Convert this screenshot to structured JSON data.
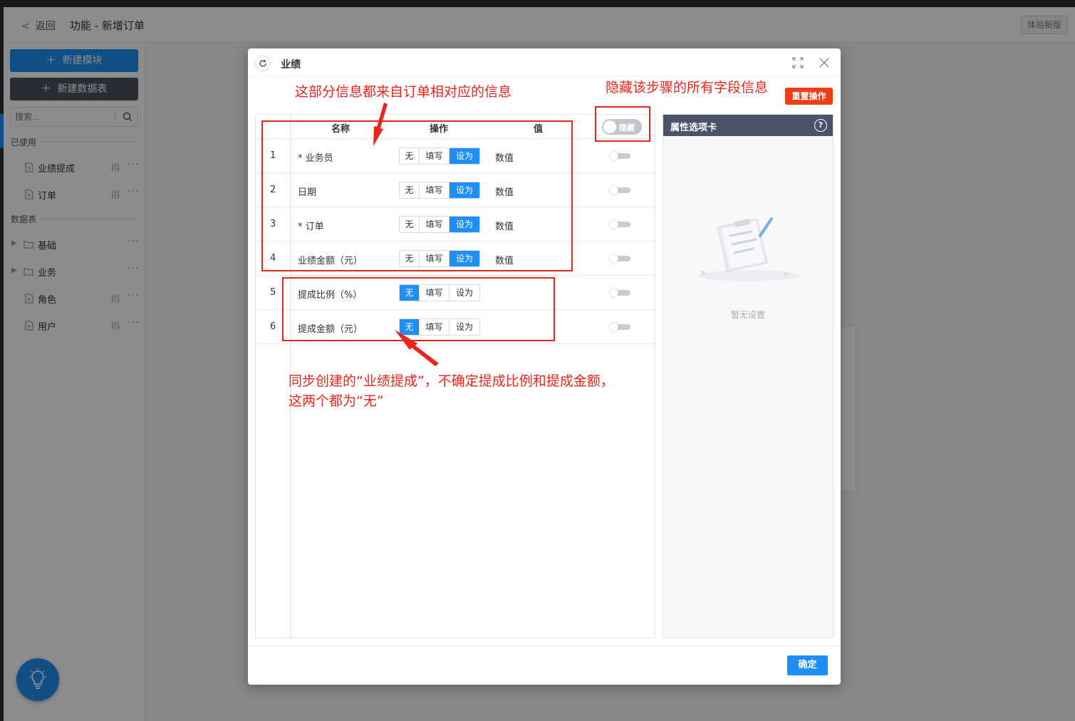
{
  "header": {
    "back_label": "返回",
    "breadcrumb": "功能 - 新增订单",
    "new_version_label": "体验新版"
  },
  "sidebar": {
    "new_module_label": "新建模块",
    "new_table_label": "新建数据表",
    "search_placeholder": "搜索...",
    "used_section_label": "已使用",
    "used_items": [
      {
        "label": "业绩提成"
      },
      {
        "label": "订单"
      }
    ],
    "tables_section_label": "数据表",
    "table_items": [
      {
        "label": "基础",
        "type": "folder"
      },
      {
        "label": "业务",
        "type": "folder"
      },
      {
        "label": "角色",
        "type": "file"
      },
      {
        "label": "用户",
        "type": "file"
      }
    ]
  },
  "dialog": {
    "title": "业绩",
    "reset_label": "重置操作",
    "confirm_label": "确定",
    "table": {
      "headers": {
        "name": "名称",
        "op": "操作",
        "value": "值"
      },
      "hide_toggle_label": "隐藏",
      "rows": [
        {
          "index": "1",
          "name": "* 业务员",
          "options": [
            "无",
            "填写",
            "设为"
          ],
          "selected": 2,
          "value": "数值"
        },
        {
          "index": "2",
          "name": "日期",
          "options": [
            "无",
            "填写",
            "设为"
          ],
          "selected": 2,
          "value": "数值"
        },
        {
          "index": "3",
          "name": "* 订单",
          "options": [
            "无",
            "填写",
            "设为"
          ],
          "selected": 2,
          "value": "数值"
        },
        {
          "index": "4",
          "name": "业绩金额（元）",
          "options": [
            "无",
            "填写",
            "设为"
          ],
          "selected": 2,
          "value": "数值"
        },
        {
          "index": "5",
          "name": "提成比例（%）",
          "options": [
            "无",
            "填写",
            "设为"
          ],
          "selected": 0,
          "value": ""
        },
        {
          "index": "6",
          "name": "提成金额（元）",
          "options": [
            "无",
            "填写",
            "设为"
          ],
          "selected": 0,
          "value": ""
        }
      ]
    },
    "props_panel": {
      "title": "属性选项卡",
      "help_label": "?",
      "empty_text": "暂无设置"
    }
  },
  "annotations": {
    "top_note": "这部分信息都来自订单相对应的信息",
    "hide_note": "隐藏该步骤的所有字段信息",
    "bottom_note_line1": "同步创建的“业绩提成”，不确定提成比例和提成金额，",
    "bottom_note_line2": "这两个都为“无”",
    "color": "#e8261d"
  },
  "colors": {
    "primary": "#1e8ff5",
    "danger": "#ee3d16",
    "dark": "#4a5263"
  }
}
